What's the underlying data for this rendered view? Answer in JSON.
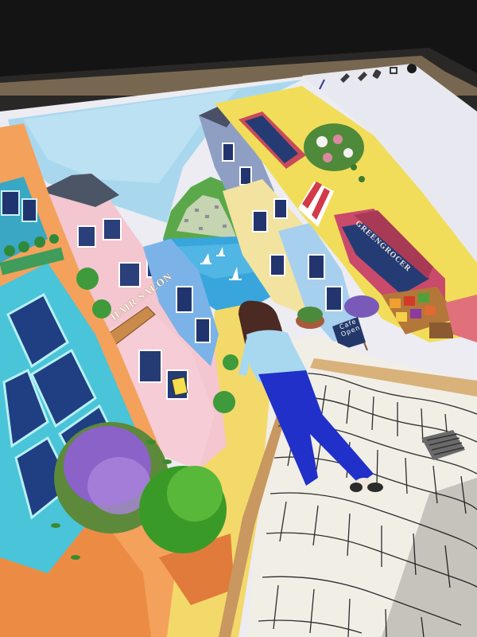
{
  "scene": {
    "hair_salon_sign": "HAIR SALON",
    "shop_sign": "GREENGROCER",
    "chalkboard": "Cafe Open"
  },
  "app": {
    "toolbar_icons": [
      "brush-icon",
      "smudge-icon",
      "eraser-icon",
      "layers-icon",
      "color-icon"
    ]
  },
  "colors": {
    "sky": "#a9d8ee",
    "sea": "#38a6dc",
    "yellow_building": "#f2dd5a",
    "pink_building": "#f3c6d0",
    "blue_trousers": "#2030c8",
    "orange_wall": "#f4a15c",
    "cobblestone": "#f1eee6"
  }
}
